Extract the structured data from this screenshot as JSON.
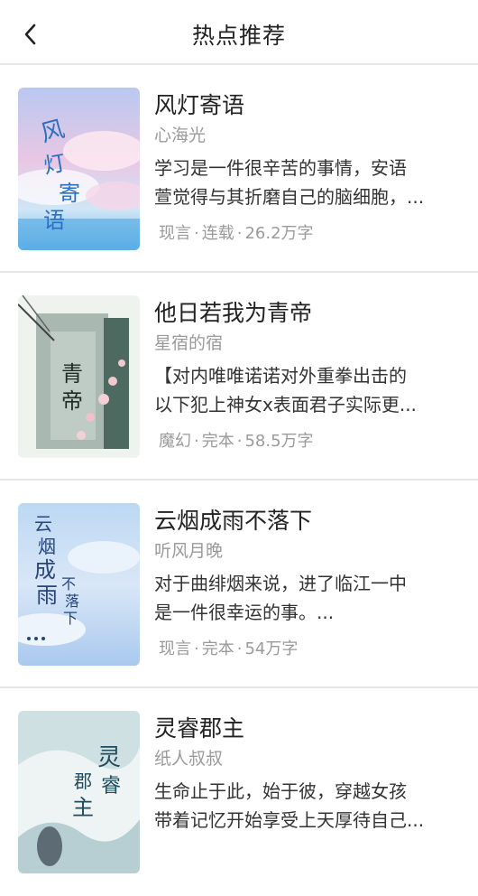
{
  "header": {
    "title": "热点推荐",
    "back_icon": "chevron-left-icon"
  },
  "books": [
    {
      "title": "风灯寄语",
      "author": "心海光",
      "desc_line1": "学习是一件很辛苦的事情，安语",
      "desc_line2": "萱觉得与其折磨自己的脑细胞，...",
      "category": "现言",
      "status": "连载",
      "words": "26.2万字",
      "cover_text": "风灯寄语"
    },
    {
      "title": "他日若我为青帝",
      "author": "星宿的宿",
      "desc_line1": "【对内唯唯诺诺对外重拳出击的",
      "desc_line2": "以下犯上神女x表面君子实际更...",
      "category": "魔幻",
      "status": "完本",
      "words": "58.5万字",
      "cover_text": "青帝"
    },
    {
      "title": "云烟成雨不落下",
      "author": "听风月晚",
      "desc_line1": "对于曲绯烟来说，进了临江一中",
      "desc_line2": "是一件很幸运的事。...",
      "category": "现言",
      "status": "完本",
      "words": "54万字",
      "cover_text": "云烟成雨"
    },
    {
      "title": "灵睿郡主",
      "author": "纸人叔叔",
      "desc_line1": "生命止于此，始于彼，穿越女孩",
      "desc_line2": "带着记忆开始享受上天厚待自己...",
      "category": "",
      "status": "",
      "words": "",
      "cover_text": "灵睿郡主"
    }
  ]
}
